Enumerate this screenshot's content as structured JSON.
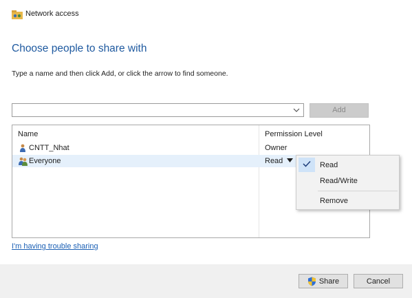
{
  "window": {
    "title": "Network access"
  },
  "heading": "Choose people to share with",
  "instruction": "Type a name and then click Add, or click the arrow to find someone.",
  "name_input": {
    "value": "",
    "placeholder": ""
  },
  "add_button": {
    "label": "Add",
    "enabled": false
  },
  "table": {
    "columns": [
      "Name",
      "Permission Level"
    ],
    "rows": [
      {
        "name": "CNTT_Nhat",
        "permission": "Owner",
        "icon": "user-icon",
        "selected": false
      },
      {
        "name": "Everyone",
        "permission": "Read",
        "icon": "group-icon",
        "selected": true
      }
    ]
  },
  "permission_menu": {
    "items": [
      "Read",
      "Read/Write",
      "Remove"
    ],
    "checked": "Read"
  },
  "help_link": "I'm having trouble sharing",
  "footer": {
    "share_label": "Share",
    "cancel_label": "Cancel"
  },
  "colors": {
    "heading": "#1f5aa0",
    "link": "#1a5fb4",
    "selected_row": "#e5f0fb",
    "footer_bg": "#f0f0f0"
  }
}
